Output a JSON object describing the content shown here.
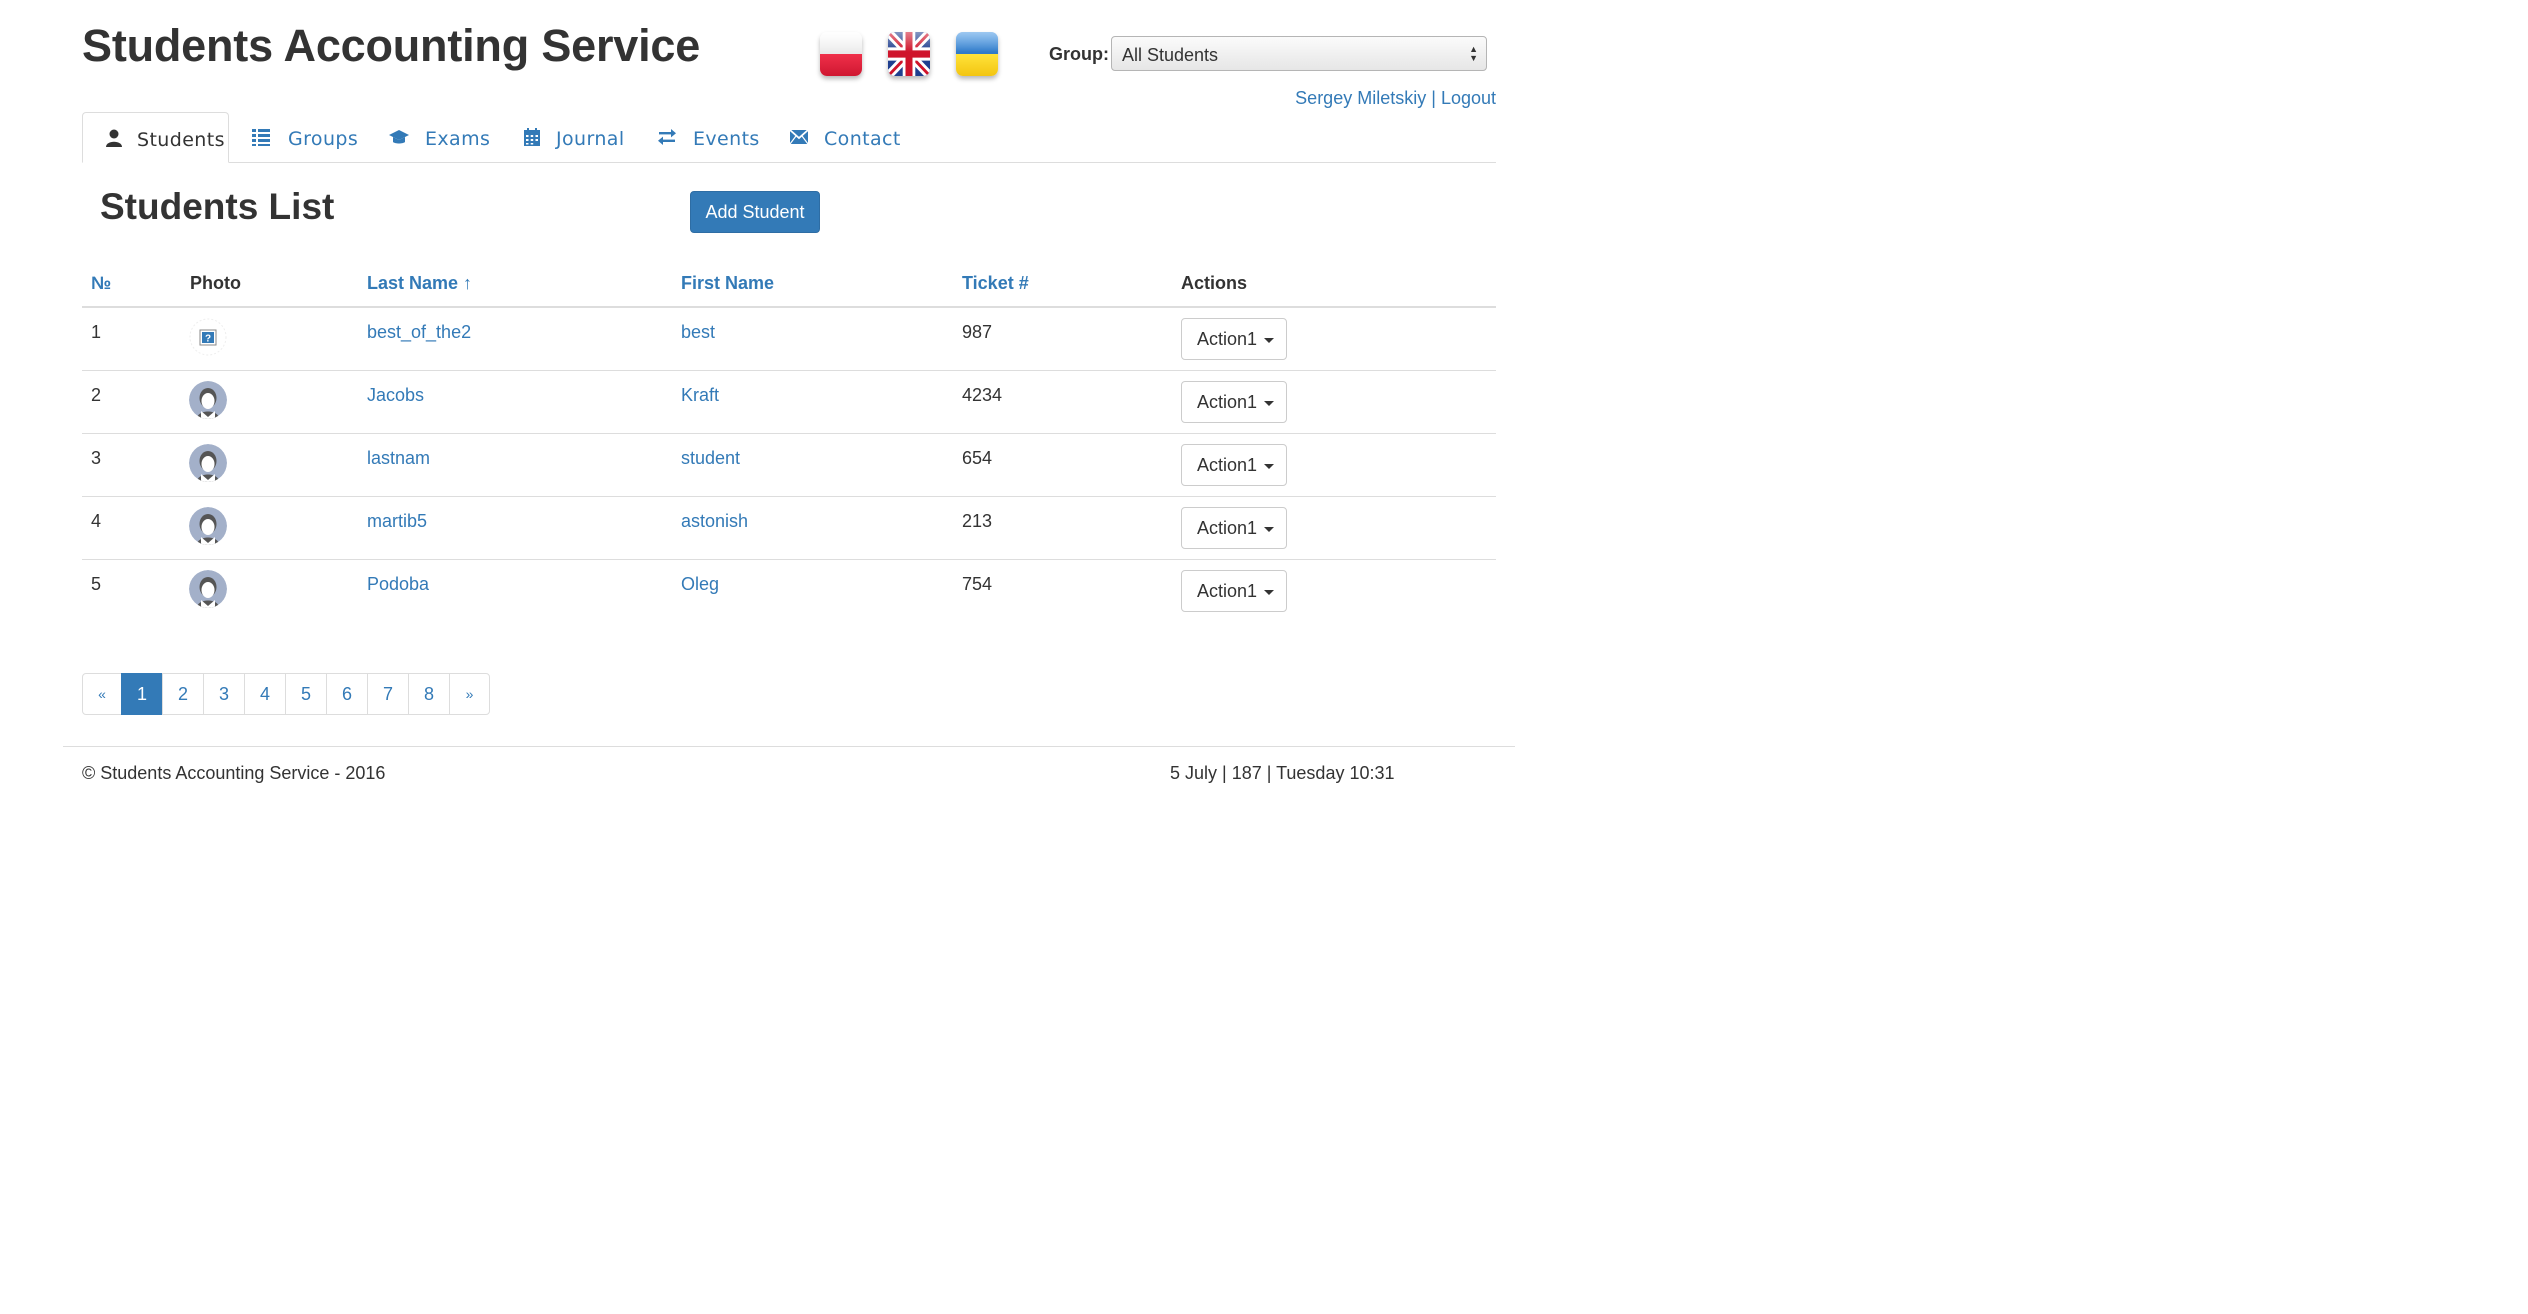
{
  "app": {
    "title": "Students Accounting Service"
  },
  "languages": [
    {
      "icon": "flag-poland-icon"
    },
    {
      "icon": "flag-uk-icon"
    },
    {
      "icon": "flag-ukraine-icon"
    }
  ],
  "group": {
    "label": "Group:",
    "selected": "All Students"
  },
  "user": {
    "name": "Sergey Miletskiy",
    "separator": "|",
    "logout": "Logout"
  },
  "tabs": [
    {
      "label": "Students",
      "icon": "user-icon",
      "active": true
    },
    {
      "label": "Groups",
      "icon": "list-icon"
    },
    {
      "label": "Exams",
      "icon": "graduation-cap-icon"
    },
    {
      "label": "Journal",
      "icon": "calendar-icon"
    },
    {
      "label": "Events",
      "icon": "transfer-icon"
    },
    {
      "label": "Contact",
      "icon": "envelope-icon"
    }
  ],
  "main": {
    "title": "Students List",
    "add_button": "Add Student"
  },
  "table": {
    "headers": {
      "num": "№",
      "photo": "Photo",
      "last": "Last Name ↑",
      "first": "First Name",
      "ticket": "Ticket #",
      "actions": "Actions"
    },
    "rows": [
      {
        "num": "1",
        "photo": "placeholder-image-icon",
        "last": "best_of_the2",
        "first": "best",
        "ticket": "987",
        "action": "Action1"
      },
      {
        "num": "2",
        "photo": "default-avatar-icon",
        "last": "Jacobs",
        "first": "Kraft",
        "ticket": "4234",
        "action": "Action1"
      },
      {
        "num": "3",
        "photo": "default-avatar-icon",
        "last": "lastnam",
        "first": "student",
        "ticket": "654",
        "action": "Action1"
      },
      {
        "num": "4",
        "photo": "default-avatar-icon",
        "last": "martib5",
        "first": "astonish",
        "ticket": "213",
        "action": "Action1"
      },
      {
        "num": "5",
        "photo": "default-avatar-icon",
        "last": "Podoba",
        "first": "Oleg",
        "ticket": "754",
        "action": "Action1"
      }
    ]
  },
  "pagination": {
    "prev": "«",
    "next": "»",
    "pages": [
      "1",
      "2",
      "3",
      "4",
      "5",
      "6",
      "7",
      "8"
    ],
    "current": "1"
  },
  "footer": {
    "copyright": "© Students Accounting Service - 2016",
    "datetime": "5 July | 187 | Tuesday 10:31"
  },
  "colors": {
    "link": "#337ab7",
    "primary": "#337ab7",
    "text": "#333333",
    "border": "#dddddd"
  }
}
